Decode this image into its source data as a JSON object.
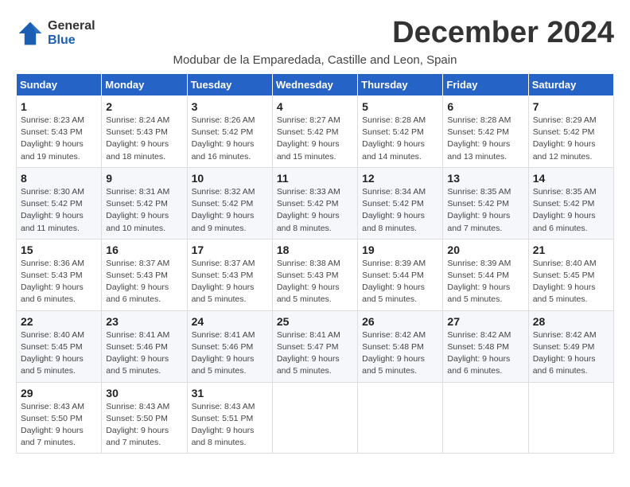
{
  "header": {
    "logo_line1": "General",
    "logo_line2": "Blue",
    "month_title": "December 2024",
    "subtitle": "Modubar de la Emparedada, Castille and Leon, Spain"
  },
  "weekdays": [
    "Sunday",
    "Monday",
    "Tuesday",
    "Wednesday",
    "Thursday",
    "Friday",
    "Saturday"
  ],
  "weeks": [
    [
      {
        "day": "1",
        "sunrise": "8:23 AM",
        "sunset": "5:43 PM",
        "daylight": "9 hours and 19 minutes."
      },
      {
        "day": "2",
        "sunrise": "8:24 AM",
        "sunset": "5:43 PM",
        "daylight": "9 hours and 18 minutes."
      },
      {
        "day": "3",
        "sunrise": "8:26 AM",
        "sunset": "5:42 PM",
        "daylight": "9 hours and 16 minutes."
      },
      {
        "day": "4",
        "sunrise": "8:27 AM",
        "sunset": "5:42 PM",
        "daylight": "9 hours and 15 minutes."
      },
      {
        "day": "5",
        "sunrise": "8:28 AM",
        "sunset": "5:42 PM",
        "daylight": "9 hours and 14 minutes."
      },
      {
        "day": "6",
        "sunrise": "8:28 AM",
        "sunset": "5:42 PM",
        "daylight": "9 hours and 13 minutes."
      },
      {
        "day": "7",
        "sunrise": "8:29 AM",
        "sunset": "5:42 PM",
        "daylight": "9 hours and 12 minutes."
      }
    ],
    [
      {
        "day": "8",
        "sunrise": "8:30 AM",
        "sunset": "5:42 PM",
        "daylight": "9 hours and 11 minutes."
      },
      {
        "day": "9",
        "sunrise": "8:31 AM",
        "sunset": "5:42 PM",
        "daylight": "9 hours and 10 minutes."
      },
      {
        "day": "10",
        "sunrise": "8:32 AM",
        "sunset": "5:42 PM",
        "daylight": "9 hours and 9 minutes."
      },
      {
        "day": "11",
        "sunrise": "8:33 AM",
        "sunset": "5:42 PM",
        "daylight": "9 hours and 8 minutes."
      },
      {
        "day": "12",
        "sunrise": "8:34 AM",
        "sunset": "5:42 PM",
        "daylight": "9 hours and 8 minutes."
      },
      {
        "day": "13",
        "sunrise": "8:35 AM",
        "sunset": "5:42 PM",
        "daylight": "9 hours and 7 minutes."
      },
      {
        "day": "14",
        "sunrise": "8:35 AM",
        "sunset": "5:42 PM",
        "daylight": "9 hours and 6 minutes."
      }
    ],
    [
      {
        "day": "15",
        "sunrise": "8:36 AM",
        "sunset": "5:43 PM",
        "daylight": "9 hours and 6 minutes."
      },
      {
        "day": "16",
        "sunrise": "8:37 AM",
        "sunset": "5:43 PM",
        "daylight": "9 hours and 6 minutes."
      },
      {
        "day": "17",
        "sunrise": "8:37 AM",
        "sunset": "5:43 PM",
        "daylight": "9 hours and 5 minutes."
      },
      {
        "day": "18",
        "sunrise": "8:38 AM",
        "sunset": "5:43 PM",
        "daylight": "9 hours and 5 minutes."
      },
      {
        "day": "19",
        "sunrise": "8:39 AM",
        "sunset": "5:44 PM",
        "daylight": "9 hours and 5 minutes."
      },
      {
        "day": "20",
        "sunrise": "8:39 AM",
        "sunset": "5:44 PM",
        "daylight": "9 hours and 5 minutes."
      },
      {
        "day": "21",
        "sunrise": "8:40 AM",
        "sunset": "5:45 PM",
        "daylight": "9 hours and 5 minutes."
      }
    ],
    [
      {
        "day": "22",
        "sunrise": "8:40 AM",
        "sunset": "5:45 PM",
        "daylight": "9 hours and 5 minutes."
      },
      {
        "day": "23",
        "sunrise": "8:41 AM",
        "sunset": "5:46 PM",
        "daylight": "9 hours and 5 minutes."
      },
      {
        "day": "24",
        "sunrise": "8:41 AM",
        "sunset": "5:46 PM",
        "daylight": "9 hours and 5 minutes."
      },
      {
        "day": "25",
        "sunrise": "8:41 AM",
        "sunset": "5:47 PM",
        "daylight": "9 hours and 5 minutes."
      },
      {
        "day": "26",
        "sunrise": "8:42 AM",
        "sunset": "5:48 PM",
        "daylight": "9 hours and 5 minutes."
      },
      {
        "day": "27",
        "sunrise": "8:42 AM",
        "sunset": "5:48 PM",
        "daylight": "9 hours and 6 minutes."
      },
      {
        "day": "28",
        "sunrise": "8:42 AM",
        "sunset": "5:49 PM",
        "daylight": "9 hours and 6 minutes."
      }
    ],
    [
      {
        "day": "29",
        "sunrise": "8:43 AM",
        "sunset": "5:50 PM",
        "daylight": "9 hours and 7 minutes."
      },
      {
        "day": "30",
        "sunrise": "8:43 AM",
        "sunset": "5:50 PM",
        "daylight": "9 hours and 7 minutes."
      },
      {
        "day": "31",
        "sunrise": "8:43 AM",
        "sunset": "5:51 PM",
        "daylight": "9 hours and 8 minutes."
      },
      null,
      null,
      null,
      null
    ]
  ]
}
